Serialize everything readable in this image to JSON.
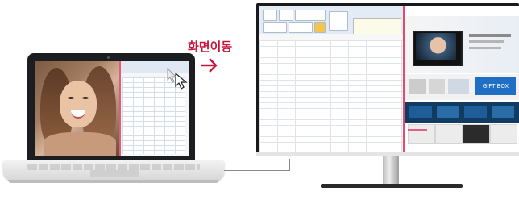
{
  "label": {
    "text": "화면이동",
    "color": "#c8173f"
  },
  "laptop": {
    "left_pane": "photo-of-woman",
    "right_pane": "spreadsheet-window"
  },
  "monitor": {
    "left_pane": "spreadsheet-window",
    "right_pane": "web-page",
    "gift_banner_text": "GIFT BOX"
  }
}
